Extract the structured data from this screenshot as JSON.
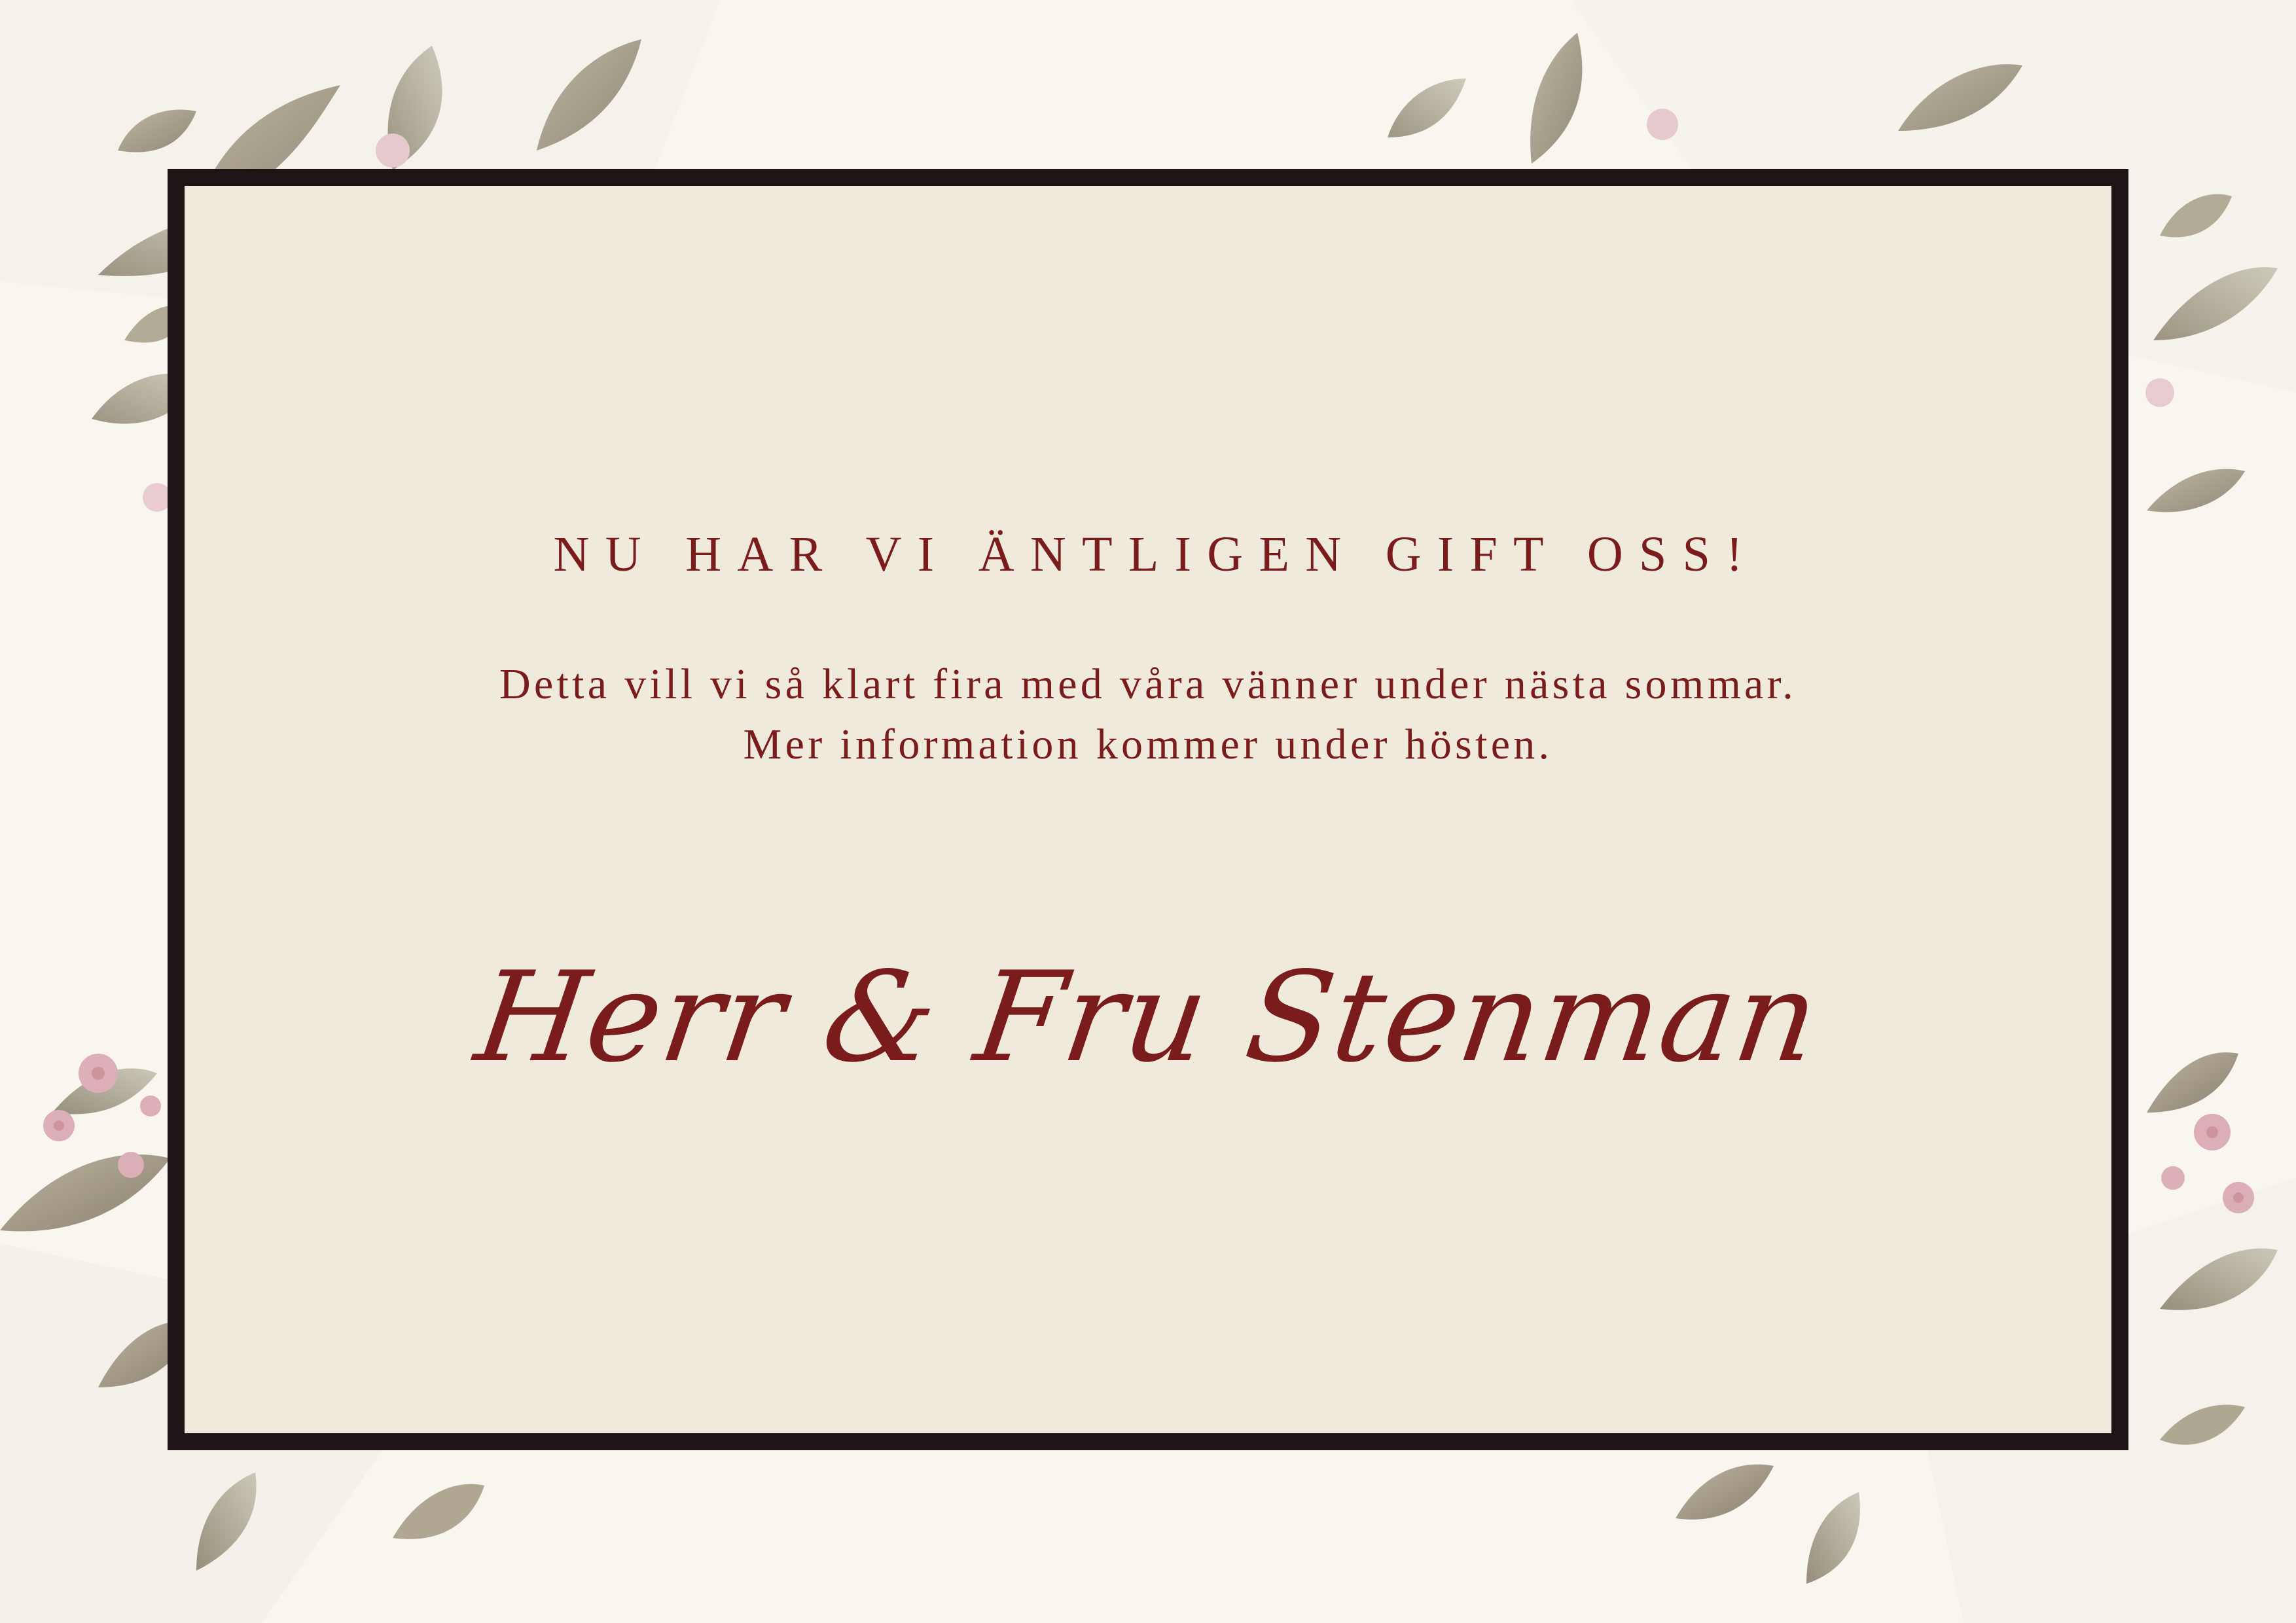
{
  "card": {
    "headline": "NU HAR VI ÄNTLIGEN GIFT OSS!",
    "body_line_1": "Detta vill vi så klart fira med våra vänner under nästa sommar.",
    "body_line_2": "Mer information kommer under hösten.",
    "signature": "Herr & Fru Stenman"
  },
  "colors": {
    "background": "#f8f6ef",
    "card_fill": "#f0eadc",
    "frame_border": "#1f1415",
    "text_accent": "#7a1c1c",
    "leaf": "#9a9478",
    "leaf_dark": "#7e7563",
    "blossom": "#d9a7b1"
  },
  "decoration": {
    "leaf_icon": "watercolor-leaf",
    "flower_icon": "pink-blossom"
  }
}
